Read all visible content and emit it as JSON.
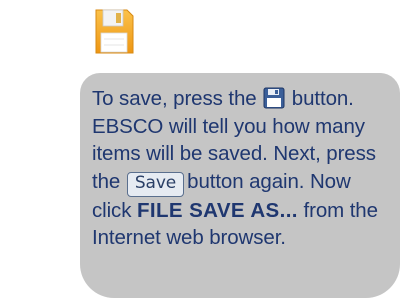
{
  "instruction": {
    "line1_pre": "To save, press the",
    "line1_post": "button.",
    "line2": "EBSCO will tell you how many",
    "line3": "items will be saved. Next, press",
    "line4_pre": "the",
    "save_button_label": "Save",
    "line4_post": "button again. Now",
    "line5_pre": "click",
    "line5_bold": "FILE SAVE AS...",
    "line5_post": "from the",
    "line6": "Internet web browser."
  },
  "icons": {
    "large": "floppy-disk-icon",
    "inline": "floppy-disk-icon"
  },
  "colors": {
    "callout_background": "#c5c5c5",
    "text": "#1f3770",
    "floppy_orange": "#f4a51c"
  }
}
